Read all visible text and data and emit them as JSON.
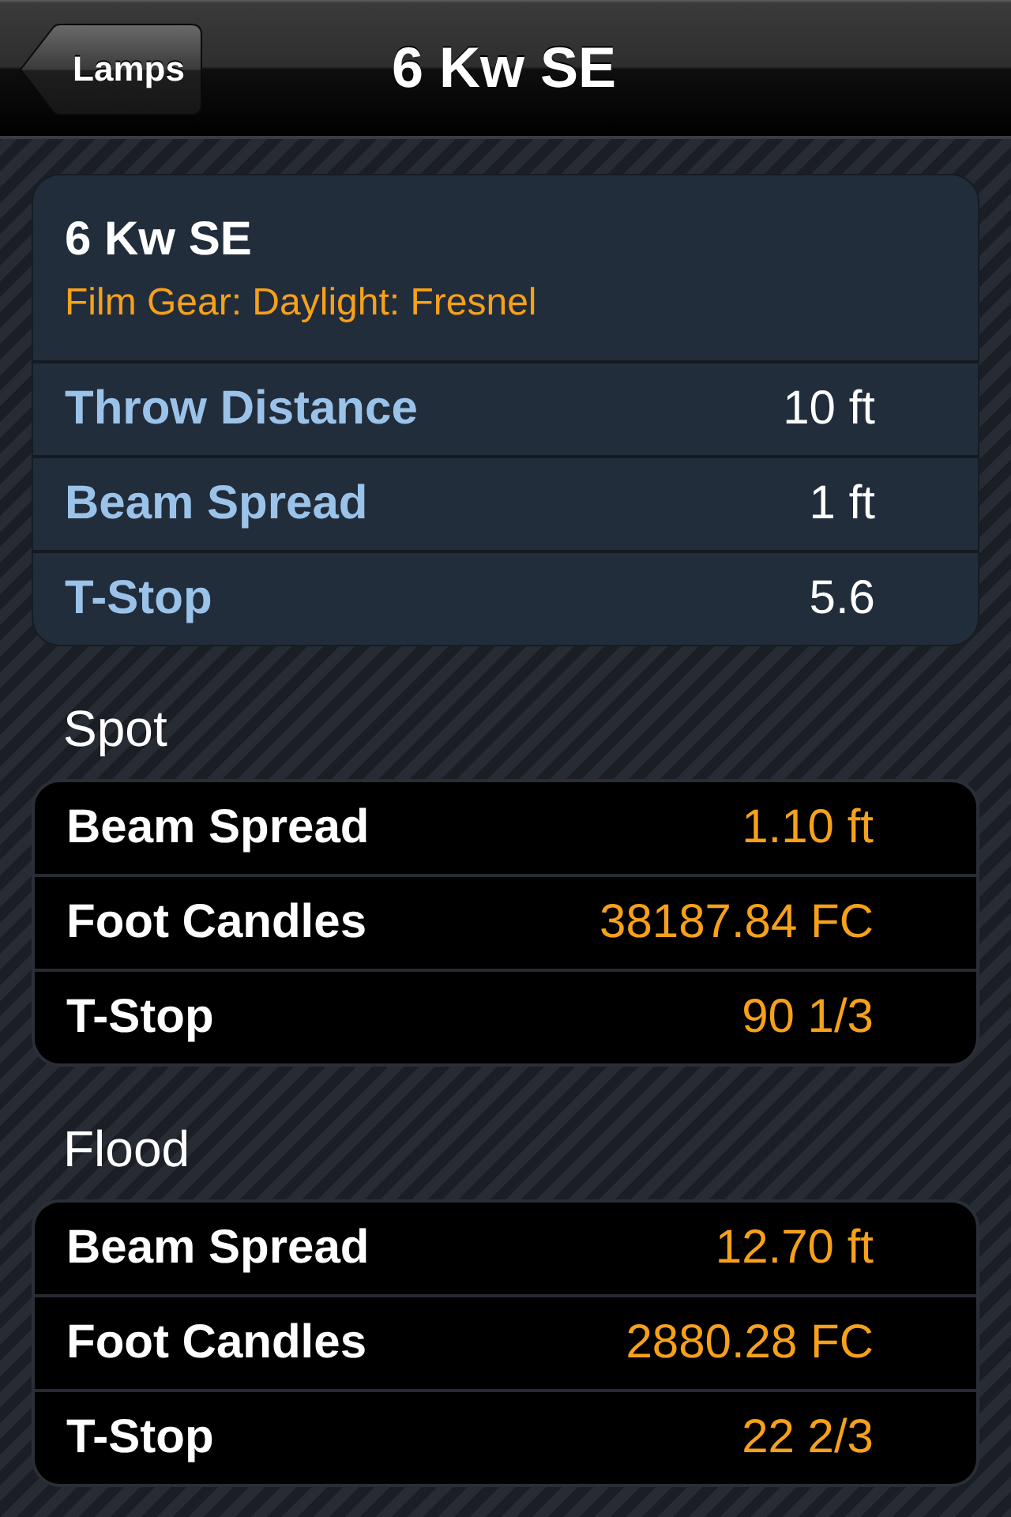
{
  "nav_bar": {
    "back_button": "Lamps",
    "title": "6 Kw SE"
  },
  "lamp_card": {
    "title": "6 Kw SE",
    "subtitle": "Film Gear: Daylight: Fresnel",
    "rows": [
      {
        "label": "Throw Distance",
        "value": "10 ft"
      },
      {
        "label": "Beam Spread",
        "value": "1 ft"
      },
      {
        "label": "T-Stop",
        "value": "5.6"
      }
    ]
  },
  "sections": [
    {
      "heading": "Spot",
      "rows": [
        {
          "label": "Beam Spread",
          "value": "1.10 ft"
        },
        {
          "label": "Foot Candles",
          "value": "38187.84 FC"
        },
        {
          "label": "T-Stop",
          "value": "90 1/3"
        }
      ]
    },
    {
      "heading": "Flood",
      "rows": [
        {
          "label": "Beam Spread",
          "value": "12.70 ft"
        },
        {
          "label": "Foot Candles",
          "value": "2880.28 FC"
        },
        {
          "label": "T-Stop",
          "value": "22 2/3"
        }
      ]
    }
  ]
}
